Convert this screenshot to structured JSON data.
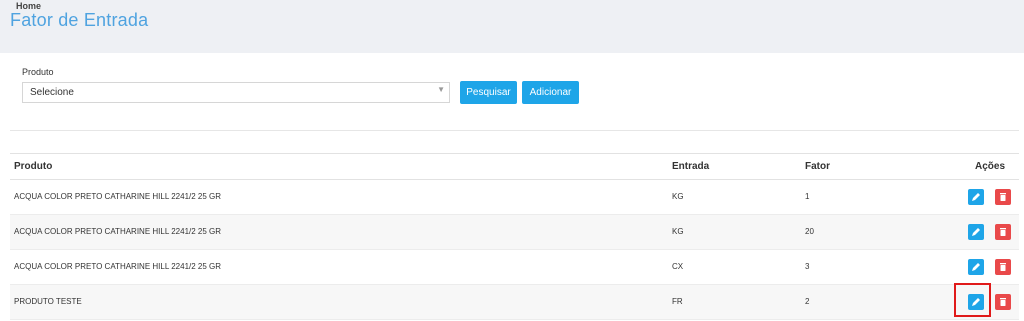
{
  "header": {
    "breadcrumb": "Home",
    "title": "Fator de Entrada"
  },
  "filter": {
    "label": "Produto",
    "select_value": "Selecione",
    "search_label": "Pesquisar",
    "add_label": "Adicionar"
  },
  "table": {
    "headers": {
      "produto": "Produto",
      "entrada": "Entrada",
      "fator": "Fator",
      "acoes": "Ações"
    },
    "rows": [
      {
        "produto": "ACQUA COLOR PRETO CATHARINE HILL 2241/2 25 GR",
        "entrada": "KG",
        "fator": "1"
      },
      {
        "produto": "ACQUA COLOR PRETO CATHARINE HILL 2241/2 25 GR",
        "entrada": "KG",
        "fator": "20"
      },
      {
        "produto": "ACQUA COLOR PRETO CATHARINE HILL 2241/2 25 GR",
        "entrada": "CX",
        "fator": "3"
      },
      {
        "produto": "PRODUTO TESTE",
        "entrada": "FR",
        "fator": "2"
      }
    ]
  },
  "icons": {
    "edit": "pencil-icon",
    "delete": "trash-icon",
    "select": "chevron-down-icon"
  },
  "colors": {
    "accent": "#1ea5e8",
    "danger": "#e9494a",
    "title": "#4fa3e0",
    "highlight": "#e01a1a"
  }
}
